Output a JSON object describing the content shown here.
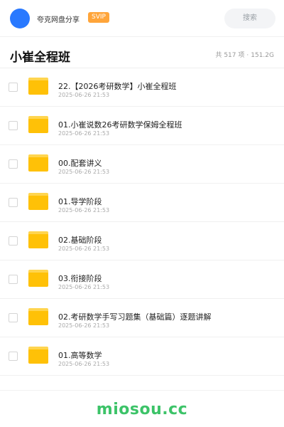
{
  "topbar": {
    "share_title": "夸克网盘分享",
    "badge": "SVIP",
    "search_placeholder": "搜索"
  },
  "header": {
    "title": "小崔全程班",
    "count": "共 517 项",
    "size": "151.2G"
  },
  "files": [
    {
      "name": "22.【2026考研数学】小崔全程班",
      "date": "2025-06-26 21:53"
    },
    {
      "name": "01.小崔说数26考研数学保姆全程班",
      "date": "2025-06-26 21:53"
    },
    {
      "name": "00.配套讲义",
      "date": "2025-06-26 21:53"
    },
    {
      "name": "01.导学阶段",
      "date": "2025-06-26 21:53"
    },
    {
      "name": "02.基础阶段",
      "date": "2025-06-26 21:53"
    },
    {
      "name": "03.衔接阶段",
      "date": "2025-06-26 21:53"
    },
    {
      "name": "02.考研数学手写习题集（基础篇）逐题讲解",
      "date": "2025-06-26 21:53"
    },
    {
      "name": "01.高等数学",
      "date": "2025-06-26 21:53"
    }
  ],
  "footer": {
    "watermark": "miosou.cc"
  },
  "colors": {
    "avatar": "#2979ff",
    "svip_badge": "#ffa53a",
    "folder": "#ffc107",
    "watermark": "#3cc368"
  }
}
